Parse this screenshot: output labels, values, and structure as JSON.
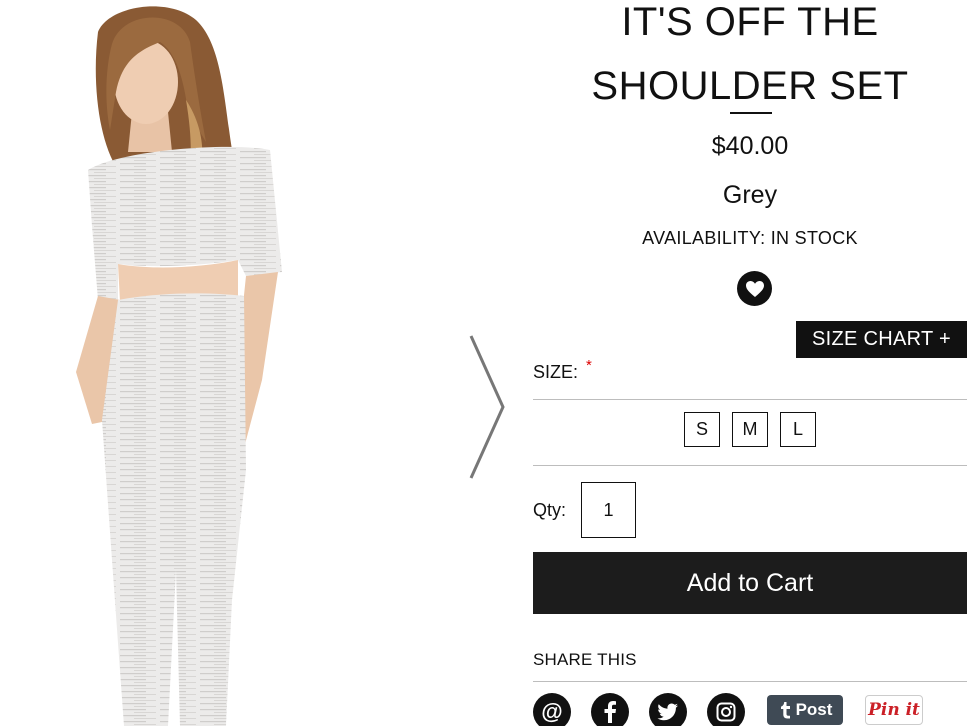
{
  "product": {
    "title_line1": "IT'S OFF THE",
    "title_line2": "SHOULDER SET",
    "price": "$40.00",
    "color": "Grey",
    "availability": "AVAILABILITY: IN STOCK"
  },
  "size": {
    "chart_label": "SIZE CHART +",
    "label": "SIZE:",
    "required_marker": "*",
    "options": [
      "S",
      "M",
      "L"
    ]
  },
  "quantity": {
    "label": "Qty:",
    "value": "1"
  },
  "cart": {
    "add_label": "Add to Cart"
  },
  "share": {
    "label": "SHARE THIS",
    "email_glyph": "@",
    "tumblr_label": "Post",
    "pinterest_label": "Pin it"
  },
  "colors": {
    "primary": "#111111",
    "button_bg": "#1c1c1c",
    "required": "#dd0000",
    "tumblr": "#3f4a55",
    "pinterest": "#cb2027"
  },
  "icons": {
    "wishlist": "heart-icon",
    "next": "chevron-right-icon",
    "share": [
      "email-icon",
      "facebook-icon",
      "twitter-icon",
      "instagram-icon",
      "tumblr-icon",
      "pinterest-icon"
    ]
  }
}
